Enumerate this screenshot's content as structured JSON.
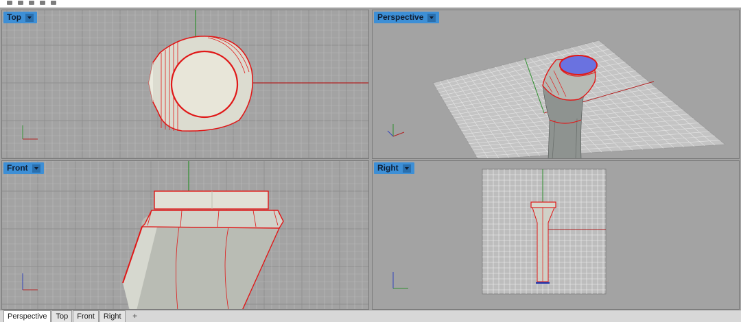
{
  "viewports": {
    "top": {
      "title": "Top"
    },
    "perspective": {
      "title": "Perspective"
    },
    "front": {
      "title": "Front"
    },
    "right": {
      "title": "Right"
    }
  },
  "tabs": [
    {
      "label": "Perspective",
      "active": true
    },
    {
      "label": "Top",
      "active": false
    },
    {
      "label": "Front",
      "active": false
    },
    {
      "label": "Right",
      "active": false
    }
  ],
  "add_tab_icon": "plus-icon",
  "colors": {
    "viewport_bg": "#a3a3a3",
    "grid_minor": "#b9b9b9",
    "grid_major": "#8f8f8f",
    "axis_x": "#b02020",
    "axis_y": "#2f8f2f",
    "edge": "#e01818",
    "surface": "#d9d9cc",
    "title_bg": "#3d8fd6",
    "cap_blue": "#6a72e0"
  }
}
